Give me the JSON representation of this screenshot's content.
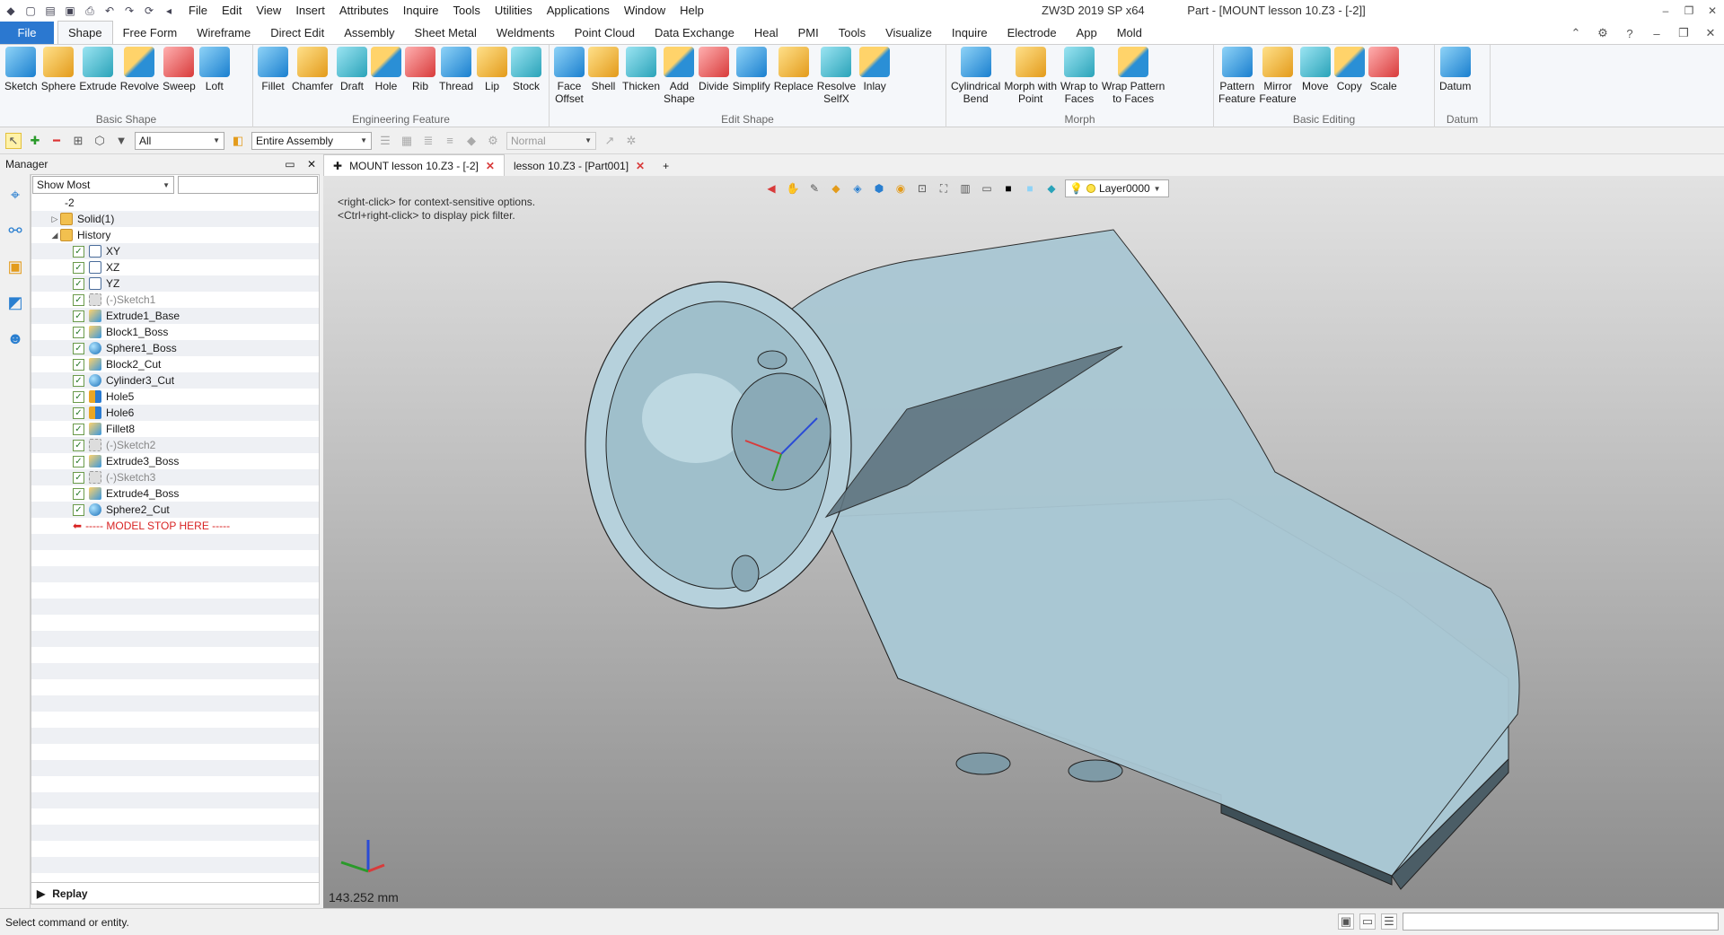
{
  "window": {
    "app_title": "ZW3D 2019 SP x64",
    "doc_title": "Part - [MOUNT lesson 10.Z3 - [-2]]"
  },
  "menus": [
    "File",
    "Edit",
    "View",
    "Insert",
    "Attributes",
    "Inquire",
    "Tools",
    "Utilities",
    "Applications",
    "Window",
    "Help"
  ],
  "ribbon_tabs": [
    "File",
    "Shape",
    "Free Form",
    "Wireframe",
    "Direct Edit",
    "Assembly",
    "Sheet Metal",
    "Weldments",
    "Point Cloud",
    "Data Exchange",
    "Heal",
    "PMI",
    "Tools",
    "Visualize",
    "Inquire",
    "Electrode",
    "App",
    "Mold"
  ],
  "ribbon": {
    "basic_shape": {
      "title": "Basic Shape",
      "tools": [
        "Sketch",
        "Sphere",
        "Extrude",
        "Revolve",
        "Sweep",
        "Loft"
      ]
    },
    "engineering_feature": {
      "title": "Engineering Feature",
      "tools": [
        "Fillet",
        "Chamfer",
        "Draft",
        "Hole",
        "Rib",
        "Thread",
        "Lip",
        "Stock"
      ]
    },
    "edit_shape": {
      "title": "Edit Shape",
      "tools": [
        [
          "Face",
          "Offset"
        ],
        [
          "Shell"
        ],
        [
          "Thicken"
        ],
        [
          "Add",
          "Shape"
        ],
        [
          "Divide"
        ],
        [
          "Simplify"
        ],
        [
          "Replace"
        ],
        [
          "Resolve",
          "SelfX"
        ],
        [
          "Inlay"
        ]
      ]
    },
    "morph": {
      "title": "Morph",
      "tools": [
        [
          "Cylindrical",
          "Bend"
        ],
        [
          "Morph with",
          "Point"
        ],
        [
          "Wrap to",
          "Faces"
        ],
        [
          "Wrap Pattern",
          "to Faces"
        ]
      ]
    },
    "basic_editing": {
      "title": "Basic Editing",
      "tools": [
        [
          "Pattern",
          "Feature"
        ],
        [
          "Mirror",
          "Feature"
        ],
        [
          "Move"
        ],
        [
          "Copy"
        ],
        [
          "Scale"
        ]
      ]
    },
    "datum": {
      "title": "Datum",
      "tools": [
        "Datum"
      ]
    }
  },
  "toolbar": {
    "filter_value": "All",
    "scope_value": "Entire Assembly",
    "mode_value": "Normal"
  },
  "manager": {
    "title": "Manager",
    "show_filter": "Show Most",
    "tree": [
      {
        "label": "-2",
        "indent": 0,
        "icon": "part"
      },
      {
        "label": "Solid(1)",
        "indent": 1,
        "icon": "folder",
        "expander": "▷"
      },
      {
        "label": "History",
        "indent": 1,
        "icon": "folder",
        "expander": "◢"
      },
      {
        "label": "XY",
        "indent": 2,
        "icon": "plane",
        "check": true
      },
      {
        "label": "XZ",
        "indent": 2,
        "icon": "plane",
        "check": true
      },
      {
        "label": "YZ",
        "indent": 2,
        "icon": "plane",
        "check": true
      },
      {
        "label": "(-)Sketch1",
        "indent": 2,
        "icon": "sketch",
        "check": true,
        "dim": true
      },
      {
        "label": "Extrude1_Base",
        "indent": 2,
        "icon": "extr",
        "check": true
      },
      {
        "label": "Block1_Boss",
        "indent": 2,
        "icon": "extr",
        "check": true
      },
      {
        "label": "Sphere1_Boss",
        "indent": 2,
        "icon": "sph",
        "check": true
      },
      {
        "label": "Block2_Cut",
        "indent": 2,
        "icon": "extr",
        "check": true
      },
      {
        "label": "Cylinder3_Cut",
        "indent": 2,
        "icon": "sph",
        "check": true
      },
      {
        "label": "Hole5",
        "indent": 2,
        "icon": "hole",
        "check": true
      },
      {
        "label": "Hole6",
        "indent": 2,
        "icon": "hole",
        "check": true
      },
      {
        "label": "Fillet8",
        "indent": 2,
        "icon": "extr",
        "check": true
      },
      {
        "label": "(-)Sketch2",
        "indent": 2,
        "icon": "sketch",
        "check": true,
        "dim": true
      },
      {
        "label": "Extrude3_Boss",
        "indent": 2,
        "icon": "extr",
        "check": true
      },
      {
        "label": "(-)Sketch3",
        "indent": 2,
        "icon": "sketch",
        "check": true,
        "dim": true
      },
      {
        "label": "Extrude4_Boss",
        "indent": 2,
        "icon": "extr",
        "check": true
      },
      {
        "label": "Sphere2_Cut",
        "indent": 2,
        "icon": "sph",
        "check": true
      },
      {
        "label": "----- MODEL STOP HERE -----",
        "indent": 2,
        "icon": "stop",
        "stop": true
      }
    ],
    "replay_label": "Replay"
  },
  "doc_tabs": [
    {
      "label": "MOUNT lesson 10.Z3 - [-2]",
      "active": true
    },
    {
      "label": "lesson 10.Z3 - [Part001]",
      "active": false
    }
  ],
  "viewport": {
    "hint_line1": "<right-click> for context-sensitive options.",
    "hint_line2": "<Ctrl+right-click> to display pick filter.",
    "layer": "Layer0000",
    "scale_readout": "143.252 mm",
    "model_color": "#a9c7d3"
  },
  "status": {
    "message": "Select command or entity."
  }
}
